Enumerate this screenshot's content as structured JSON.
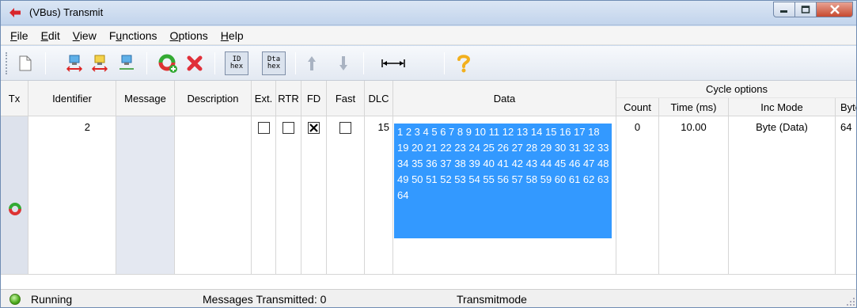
{
  "window": {
    "title": "(VBus) Transmit"
  },
  "menu": [
    {
      "label": "File",
      "u": "F",
      "rest": "ile"
    },
    {
      "label": "Edit",
      "u": "E",
      "rest": "dit"
    },
    {
      "label": "View",
      "u": "V",
      "rest": "iew"
    },
    {
      "label": "Functions",
      "u": "u",
      "pre": "F",
      "rest": "nctions"
    },
    {
      "label": "Options",
      "u": "O",
      "rest": "ptions"
    },
    {
      "label": "Help",
      "u": "H",
      "rest": "elp"
    }
  ],
  "toolbar": {
    "id_hex": [
      "ID",
      "hex"
    ],
    "dta_hex": [
      "Dta",
      "hex"
    ]
  },
  "table": {
    "headers": {
      "tx": "Tx",
      "identifier": "Identifier",
      "message": "Message",
      "description": "Description",
      "ext": "Ext.",
      "rtr": "RTR",
      "fd": "FD",
      "fast": "Fast",
      "dlc": "DLC",
      "data": "Data",
      "cycle_options": "Cycle options",
      "count": "Count",
      "time": "Time (ms)",
      "inc_mode": "Inc Mode",
      "byte": "Byte"
    },
    "row": {
      "identifier": "2",
      "message": "",
      "description": "",
      "ext": false,
      "rtr": false,
      "fd": true,
      "fast": false,
      "dlc": "15",
      "data": "1 2 3 4 5 6 7 8 9 10 11 12 13 14 15 16 17 18 19 20 21 22 23 24 25 26 27 28 29 30 31 32 33 34 35 36 37 38 39 40 41 42 43 44 45 46 47 48 49 50 51 52 53 54 55 56 57 58 59 60 61 62 63 64",
      "count": "0",
      "time": "10.00",
      "inc_mode": "Byte (Data)",
      "byte": "64"
    }
  },
  "status": {
    "state": "Running",
    "messages": "Messages Transmitted: 0",
    "mode": "Transmitmode"
  },
  "colors": {
    "selection": "#3399ff",
    "titlebar": "#c9d9ee",
    "close": "#c7492f"
  }
}
